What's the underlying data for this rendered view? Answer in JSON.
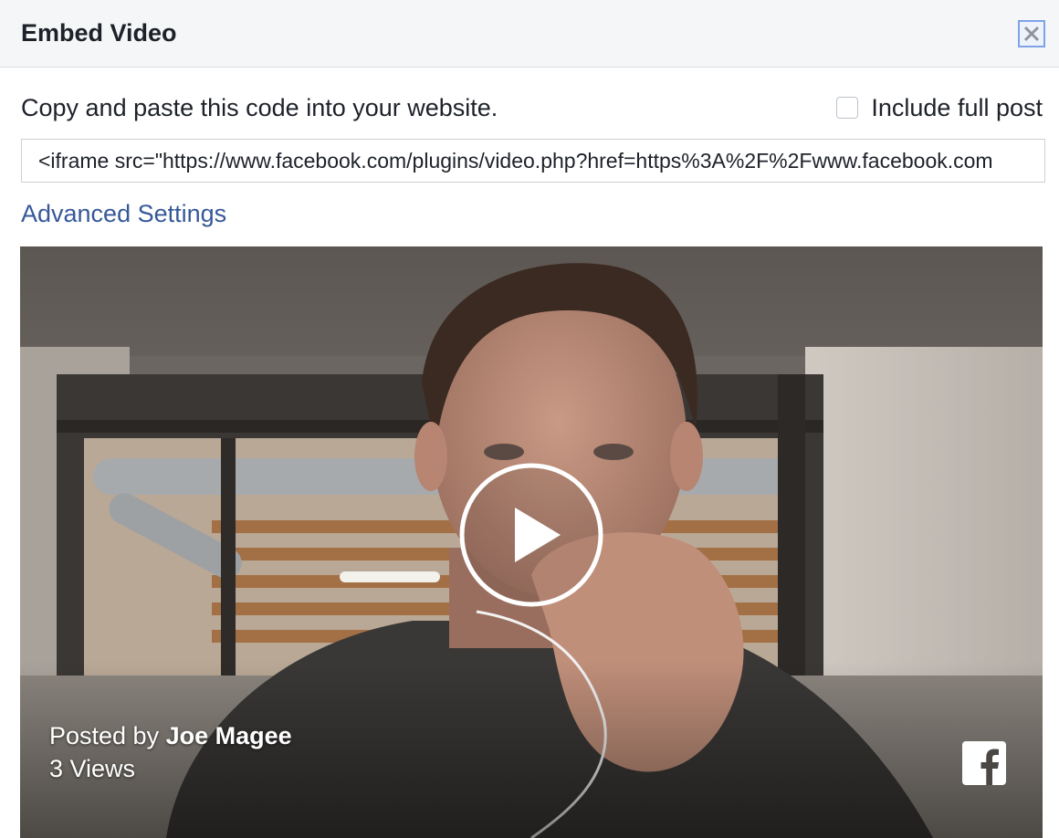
{
  "dialog": {
    "title": "Embed Video",
    "close_icon": "close-icon"
  },
  "embed": {
    "instructions": "Copy and paste this code into your website.",
    "include_full_post_label": "Include full post",
    "include_full_post_checked": false,
    "code": "<iframe src=\"https://www.facebook.com/plugins/video.php?href=https%3A%2F%2Fwww.facebook.com",
    "advanced_settings_label": "Advanced Settings"
  },
  "video": {
    "posted_by_prefix": "Posted by",
    "author": "Joe Magee",
    "views": "3 Views",
    "play_icon": "play-icon",
    "brand_icon": "facebook-logo-icon"
  },
  "colors": {
    "link": "#365899",
    "header_bg": "#f5f6f7",
    "text": "#1d2129",
    "close_focus": "#7fa2ea"
  }
}
